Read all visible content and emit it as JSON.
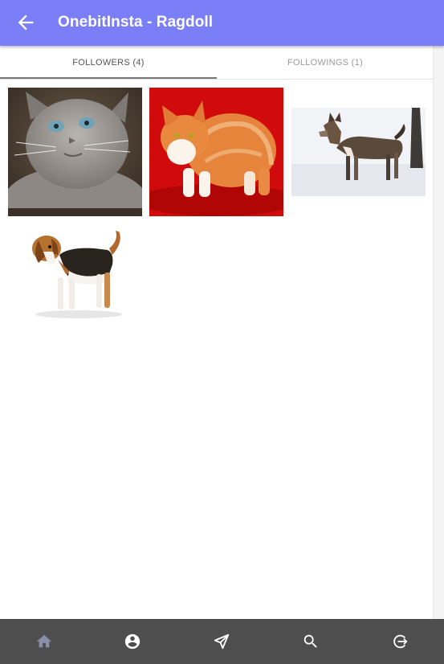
{
  "app_bar": {
    "title": "OnebitInsta - Ragdoll",
    "back_icon": "arrow-back-icon"
  },
  "tabs": [
    {
      "label": "FOLLOWERS (4)",
      "active": true
    },
    {
      "label": "FOLLOWINGS (1)",
      "active": false
    }
  ],
  "followers": [
    {
      "subject": "grey cat"
    },
    {
      "subject": "orange and white cat"
    },
    {
      "subject": "dog in snow"
    },
    {
      "subject": "beagle"
    }
  ],
  "bottom_nav": [
    {
      "icon": "home-icon",
      "active": false
    },
    {
      "icon": "account-circle-icon",
      "active": true
    },
    {
      "icon": "send-icon",
      "active": true
    },
    {
      "icon": "search-icon",
      "active": true
    },
    {
      "icon": "logout-icon",
      "active": true
    }
  ],
  "colors": {
    "app_bar": "#7b7ff7",
    "bottom_nav": "#4e4e4e",
    "nav_icon": "#ffffff",
    "nav_icon_inactive": "#8b8da8"
  }
}
